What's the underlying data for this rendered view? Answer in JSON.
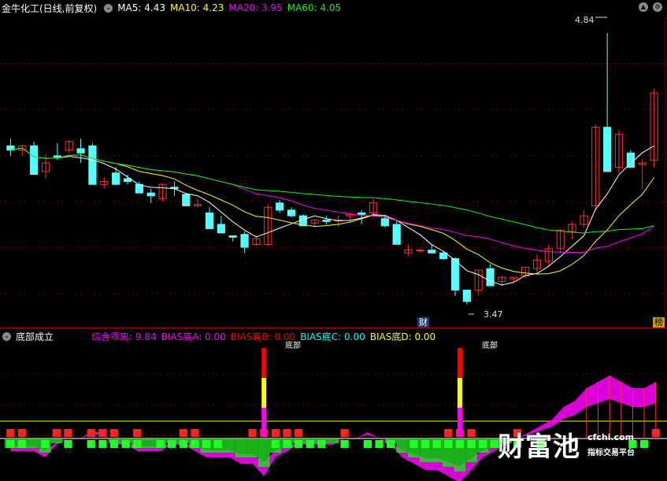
{
  "top_panel": {
    "title": "金牛化工(日线,前复权)",
    "indicators": [
      {
        "label": "MA5: 4.43",
        "color": "#ffffff"
      },
      {
        "label": "MA10: 4.23",
        "color": "#ffff00"
      },
      {
        "label": "MA20: 3.95",
        "color": "#ff00ff"
      },
      {
        "label": "MA60: 4.05",
        "color": "#00ff00"
      }
    ],
    "high_label": "4.84",
    "low_label": "3.47",
    "tag_cai": "财",
    "tag_bang": "榜",
    "control_icons": [
      "chevron-down-icon",
      "up-arrow-icon",
      "gear-icon"
    ]
  },
  "bottom_panel": {
    "title": "底部成立",
    "indicators": [
      {
        "label": "综合乖离: 9.84",
        "color": "#ff00ff"
      },
      {
        "label": "BIAS底A: 0.00",
        "color": "#ff00ff"
      },
      {
        "label": "BIAS底B: 0.00",
        "color": "#ff0000"
      },
      {
        "label": "BIAS底C: 0.00",
        "color": "#00ffff"
      },
      {
        "label": "BIAS底D: 0.00",
        "color": "#ffff00"
      }
    ],
    "signal_label_1": "底部",
    "signal_label_2": "底部"
  },
  "watermark": {
    "name": "财富池",
    "site": "cfchi.com",
    "slogan": "指标交易平台"
  },
  "chart_data": {
    "type": "candlestick",
    "up_color": "#ff3030",
    "down_color": "#54ffff",
    "ma5_color": "#ffffff",
    "ma10_color": "#ffff00",
    "ma20_color": "#ff00ff",
    "ma60_color": "#00ff00",
    "ohlc": [
      [
        4.05,
        4.1,
        3.98,
        4.02
      ],
      [
        4.02,
        4.06,
        3.98,
        4.05
      ],
      [
        4.05,
        4.08,
        3.87,
        3.85
      ],
      [
        3.87,
        3.99,
        3.82,
        3.93
      ],
      [
        3.98,
        4.07,
        3.95,
        3.97
      ],
      [
        4.02,
        4.09,
        4.0,
        4.08
      ],
      [
        4.03,
        4.1,
        3.93,
        4.0
      ],
      [
        4.05,
        4.07,
        3.78,
        3.78
      ],
      [
        3.78,
        3.83,
        3.75,
        3.8
      ],
      [
        3.86,
        3.9,
        3.8,
        3.78
      ],
      [
        3.82,
        3.85,
        3.78,
        3.8
      ],
      [
        3.78,
        3.8,
        3.72,
        3.72
      ],
      [
        3.72,
        3.75,
        3.65,
        3.7
      ],
      [
        3.68,
        3.78,
        3.66,
        3.78
      ],
      [
        3.76,
        3.8,
        3.7,
        3.75
      ],
      [
        3.71,
        3.72,
        3.66,
        3.63
      ],
      [
        3.63,
        3.68,
        3.62,
        3.64
      ],
      [
        3.58,
        3.62,
        3.52,
        3.47
      ],
      [
        3.5,
        3.56,
        3.46,
        3.44
      ],
      [
        3.42,
        3.42,
        3.38,
        3.41
      ],
      [
        3.43,
        3.45,
        3.3,
        3.34
      ],
      [
        3.36,
        3.42,
        3.35,
        3.4
      ],
      [
        3.36,
        3.64,
        3.35,
        3.62
      ],
      [
        3.65,
        3.67,
        3.58,
        3.6
      ],
      [
        3.6,
        3.62,
        3.55,
        3.56
      ],
      [
        3.56,
        3.57,
        3.5,
        3.49
      ],
      [
        3.51,
        3.53,
        3.48,
        3.53
      ],
      [
        3.53,
        3.56,
        3.5,
        3.52
      ],
      [
        3.53,
        3.56,
        3.48,
        3.53
      ],
      [
        3.56,
        3.57,
        3.52,
        3.57
      ],
      [
        3.58,
        3.6,
        3.5,
        3.57
      ],
      [
        3.58,
        3.68,
        3.55,
        3.65
      ],
      [
        3.54,
        3.56,
        3.48,
        3.49
      ],
      [
        3.5,
        3.53,
        3.42,
        3.36
      ],
      [
        3.3,
        3.36,
        3.28,
        3.32
      ],
      [
        3.32,
        3.33,
        3.3,
        3.32
      ],
      [
        3.32,
        3.36,
        3.3,
        3.3
      ],
      [
        3.3,
        3.31,
        3.25,
        3.26
      ],
      [
        3.26,
        3.27,
        3.0,
        3.04
      ],
      [
        3.04,
        3.0,
        2.94,
        2.96
      ],
      [
        3.04,
        3.18,
        3.0,
        3.18
      ],
      [
        3.19,
        3.22,
        3.1,
        3.07
      ],
      [
        3.1,
        3.14,
        3.07,
        3.13
      ],
      [
        3.12,
        3.13,
        3.1,
        3.13
      ],
      [
        3.14,
        3.2,
        3.12,
        3.2
      ],
      [
        3.19,
        3.29,
        3.15,
        3.25
      ],
      [
        3.24,
        3.36,
        3.2,
        3.33
      ],
      [
        3.33,
        3.47,
        3.3,
        3.46
      ],
      [
        3.45,
        3.52,
        3.4,
        3.5
      ],
      [
        3.5,
        3.6,
        3.48,
        3.56
      ],
      [
        3.63,
        4.2,
        3.6,
        4.18
      ],
      [
        4.18,
        4.84,
        4.05,
        3.87
      ],
      [
        3.9,
        4.16,
        3.86,
        4.13
      ],
      [
        4.0,
        4.02,
        3.9,
        3.9
      ],
      [
        3.92,
        3.96,
        3.75,
        3.93
      ],
      [
        3.95,
        4.45,
        3.9,
        4.42
      ]
    ],
    "ylim": [
      2.8,
      4.95
    ]
  },
  "bias_data": {
    "mag_band": [
      -2,
      -2,
      -2,
      -3,
      -1,
      0,
      0,
      1,
      1,
      -1,
      -1,
      -2,
      -2,
      -2,
      -1,
      -1,
      -2,
      -3,
      -3,
      -3,
      -4,
      -4,
      -6,
      -3,
      -2,
      -1,
      -1,
      -1,
      -1,
      0,
      0,
      1,
      0,
      -1,
      -3,
      -4,
      -5,
      -5,
      -6,
      -7,
      -5,
      -3,
      -2,
      -1,
      0,
      1,
      2,
      3,
      5,
      6,
      8,
      9,
      10,
      9,
      8,
      8,
      9
    ],
    "green_bars": [
      1,
      1,
      0,
      1,
      0,
      1,
      0,
      1,
      1,
      1,
      1,
      1,
      0,
      1,
      1,
      1,
      1,
      1,
      1,
      0,
      0,
      0,
      0,
      1,
      1,
      1,
      1,
      1,
      0,
      1,
      0,
      1,
      1,
      1,
      0,
      1,
      1,
      1,
      1,
      1,
      1,
      1,
      1,
      0,
      1,
      0,
      1,
      0,
      0,
      0,
      0,
      0,
      0,
      0,
      1,
      1,
      0
    ],
    "red_bars": [
      1,
      1,
      0,
      0,
      1,
      1,
      0,
      1,
      1,
      1,
      0,
      1,
      0,
      0,
      0,
      1,
      1,
      0,
      0,
      0,
      0,
      1,
      1,
      1,
      1,
      1,
      0,
      0,
      0,
      1,
      0,
      0,
      0,
      0,
      0,
      0,
      0,
      0,
      1,
      1,
      1,
      0,
      0,
      0,
      1,
      0,
      0,
      0,
      0,
      0,
      0,
      0,
      0,
      0,
      0,
      0,
      1
    ],
    "signals": [
      22,
      39
    ]
  }
}
